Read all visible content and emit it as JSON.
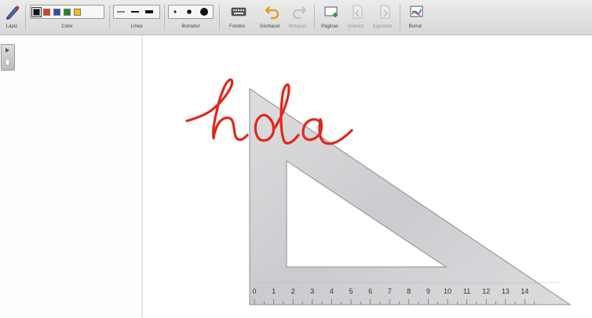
{
  "toolbar": {
    "pencil_label": "Lápiz",
    "color_label": "Color",
    "line_label": "Línea",
    "eraser_label": "Borrador",
    "backgrounds_label": "Fondos",
    "undo_label": "Deshacer",
    "redo_label": "Rehacer",
    "pages_label": "Páginas",
    "prev_label": "Anterior",
    "next_label": "Siguiente",
    "erase_all_label": "Borrar",
    "colors": [
      "#111111",
      "#e23b23",
      "#2b4fb5",
      "#1f8a2a",
      "#f2c200"
    ],
    "selected_color": "#111111"
  },
  "canvas": {
    "handwriting_text": "hola",
    "ink_color": "#e0281a",
    "set_square": {
      "ruler_marks": [
        "0",
        "1",
        "2",
        "3",
        "4",
        "5",
        "6",
        "7",
        "8",
        "9",
        "10",
        "11",
        "12",
        "13",
        "14"
      ]
    }
  }
}
